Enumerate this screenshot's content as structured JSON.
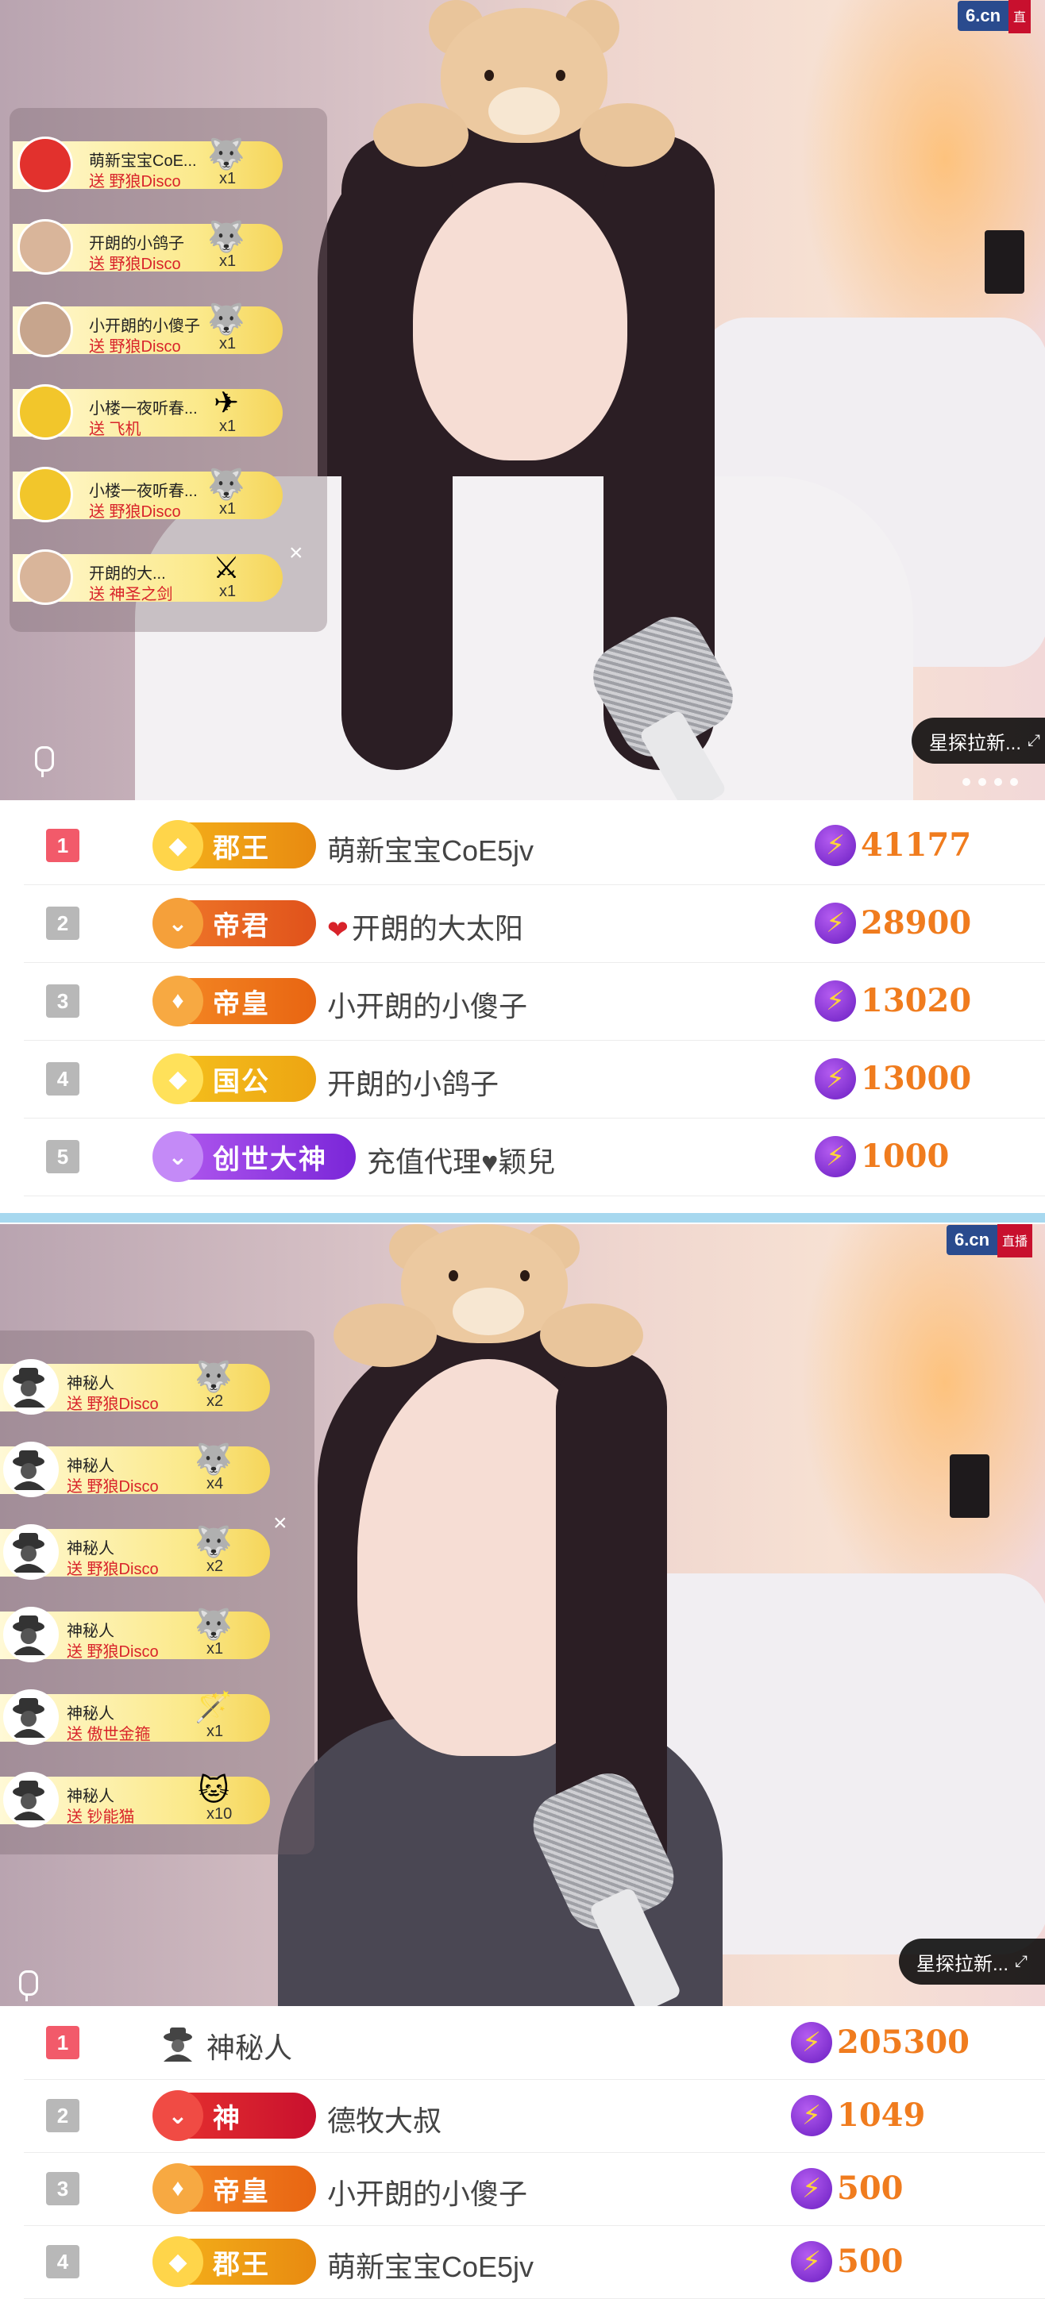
{
  "stream1": {
    "logo": {
      "brand": "6.cn",
      "live": "直"
    },
    "gifts": [
      {
        "name": "萌新宝宝CoE...",
        "action": "送 野狼Disco",
        "count": "x1",
        "gift_icon": "wolf-disco-icon"
      },
      {
        "name": "开朗的小鸽子",
        "action": "送 野狼Disco",
        "count": "x1",
        "gift_icon": "wolf-disco-icon"
      },
      {
        "name": "小开朗的小傻子",
        "action": "送 野狼Disco",
        "count": "x1",
        "gift_icon": "wolf-disco-icon"
      },
      {
        "name": "小楼一夜听春...",
        "action": "送 飞机",
        "count": "x1",
        "gift_icon": "airplane-icon"
      },
      {
        "name": "小楼一夜听春...",
        "action": "送 野狼Disco",
        "count": "x1",
        "gift_icon": "wolf-disco-icon"
      },
      {
        "name": "开朗的大...",
        "action": "送 神圣之剑",
        "count": "x1",
        "gift_icon": "holy-sword-icon"
      }
    ],
    "close": "×",
    "tag": "星探拉新...",
    "expand": "⤢"
  },
  "ranking1": [
    {
      "rank": "1",
      "badge": "郡王",
      "name": "萌新宝宝CoE5jv",
      "score": "41177"
    },
    {
      "rank": "2",
      "badge": "帝君",
      "name": "开朗的大太阳",
      "heart": "❤",
      "score": "28900"
    },
    {
      "rank": "3",
      "badge": "帝皇",
      "name": "小开朗的小傻子",
      "score": "13020"
    },
    {
      "rank": "4",
      "badge": "国公",
      "name": "开朗的小鸽子",
      "score": "13000"
    },
    {
      "rank": "5",
      "badge": "创世大神",
      "name": "充值代理♥颖兒",
      "score": "1000"
    }
  ],
  "stream2": {
    "logo": {
      "brand": "6.cn",
      "live": "直播"
    },
    "gifts": [
      {
        "name": "神秘人",
        "action": "送 野狼Disco",
        "count": "x2",
        "gift_icon": "wolf-disco-icon"
      },
      {
        "name": "神秘人",
        "action": "送 野狼Disco",
        "count": "x4",
        "gift_icon": "wolf-disco-icon"
      },
      {
        "name": "神秘人",
        "action": "送 野狼Disco",
        "count": "x2",
        "gift_icon": "wolf-disco-icon"
      },
      {
        "name": "神秘人",
        "action": "送 野狼Disco",
        "count": "x1",
        "gift_icon": "wolf-disco-icon"
      },
      {
        "name": "神秘人",
        "action": "送 傲世金箍",
        "count": "x1",
        "gift_icon": "golden-staff-icon"
      },
      {
        "name": "神秘人",
        "action": "送 钞能猫",
        "count": "x10",
        "gift_icon": "money-cat-icon"
      }
    ],
    "close": "×",
    "tag": "星探拉新...",
    "expand": "⤢"
  },
  "ranking2": [
    {
      "rank": "1",
      "name": "神秘人",
      "score": "205300"
    },
    {
      "rank": "2",
      "badge": "神",
      "name": "德牧大叔",
      "score": "1049"
    },
    {
      "rank": "3",
      "badge": "帝皇",
      "name": "小开朗的小傻子",
      "score": "500"
    },
    {
      "rank": "4",
      "badge": "郡王",
      "name": "萌新宝宝CoE5jv",
      "score": "500"
    }
  ],
  "colors": {
    "separator": "#a7d8ef",
    "score": "#f07c1e",
    "rank_top": "#f25a6a",
    "rank_other": "#b8b8b8"
  }
}
